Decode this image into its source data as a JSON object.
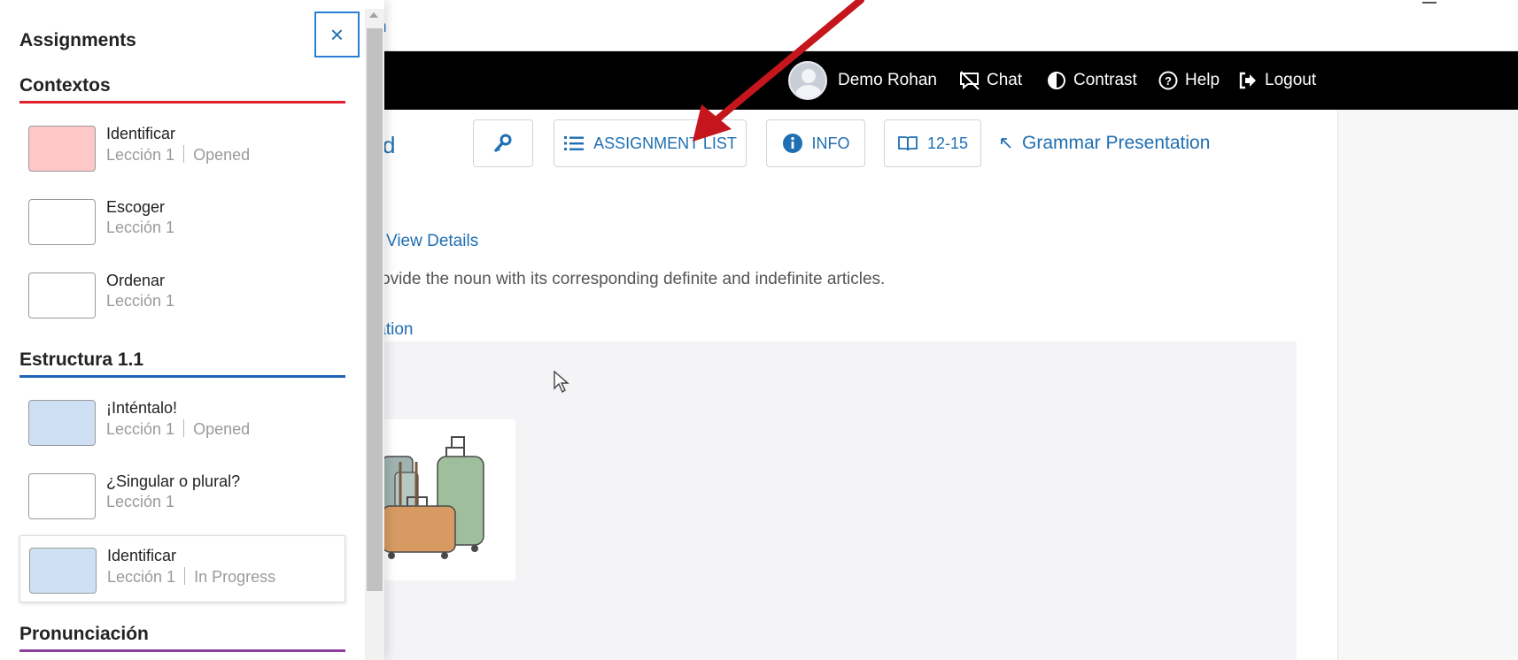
{
  "header": {
    "crumb_fragment": "n",
    "user_name": "Demo Rohan",
    "chat_label": "Chat",
    "contrast_label": "Contrast",
    "help_label": "Help",
    "logout_label": "Logout"
  },
  "toolbar": {
    "title_fragment": "board",
    "assignment_list_label": "ASSIGNMENT LIST",
    "info_label": "INFO",
    "pages_label": "12-15",
    "grammar_label": "Grammar Presentation"
  },
  "main": {
    "view_details": "View Details",
    "instruction": "ovide the noun with its corresponding definite and indefinite articles.",
    "presentation_fragment": "tation"
  },
  "drawer": {
    "title": "Assignments",
    "close_label": "×",
    "sections": [
      {
        "title": "Contextos",
        "rule_color": "#e0212b",
        "items": [
          {
            "name": "Identificar",
            "lesson": "Lección 1",
            "status": "Opened",
            "swatch": "#ffc8c8"
          },
          {
            "name": "Escoger",
            "lesson": "Lección 1",
            "status": "",
            "swatch": "#ffffff"
          },
          {
            "name": "Ordenar",
            "lesson": "Lección 1",
            "status": "",
            "swatch": "#ffffff"
          }
        ]
      },
      {
        "title": "Estructura 1.1",
        "rule_color": "#1f63b8",
        "items": [
          {
            "name": "¡Inténtalo!",
            "lesson": "Lección 1",
            "status": "Opened",
            "swatch": "#cfe0f5"
          },
          {
            "name": "¿Singular o plural?",
            "lesson": "Lección 1",
            "status": "",
            "swatch": "#ffffff"
          },
          {
            "name": "Identificar",
            "lesson": "Lección 1",
            "status": "In Progress",
            "swatch": "#cfe0f5"
          }
        ]
      },
      {
        "title": "Pronunciación",
        "rule_color": "#8e3f9e",
        "items": []
      }
    ]
  },
  "colors": {
    "link_blue": "#1f6fb2",
    "annotation_arrow": "#c4161c",
    "nav_bar": "#000000"
  }
}
